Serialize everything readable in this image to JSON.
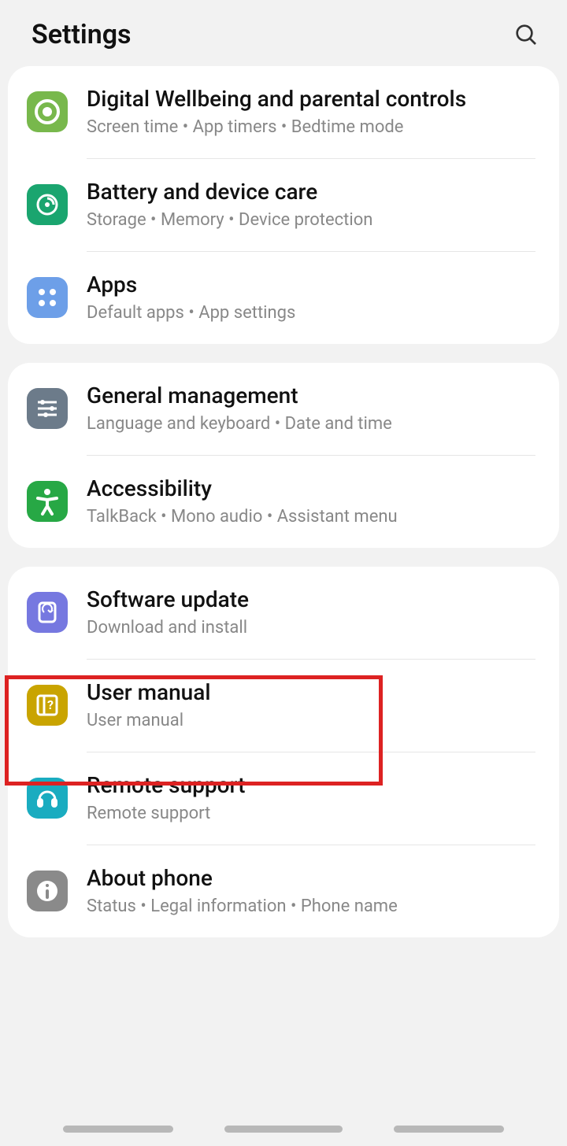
{
  "header": {
    "title": "Settings"
  },
  "groups": [
    {
      "items": [
        {
          "id": "digital-wellbeing",
          "title": "Digital Wellbeing and parental controls",
          "subtitle": "Screen time • App timers • Bedtime mode",
          "color": "#78b84c"
        },
        {
          "id": "battery",
          "title": "Battery and device care",
          "subtitle": "Storage • Memory • Device protection",
          "color": "#1aa56f"
        },
        {
          "id": "apps",
          "title": "Apps",
          "subtitle": "Default apps • App settings",
          "color": "#6d9fe8"
        }
      ]
    },
    {
      "items": [
        {
          "id": "general",
          "title": "General management",
          "subtitle": "Language and keyboard • Date and time",
          "color": "#6c7b8a"
        },
        {
          "id": "accessibility",
          "title": "Accessibility",
          "subtitle": "TalkBack • Mono audio • Assistant menu",
          "color": "#27a845"
        }
      ]
    },
    {
      "items": [
        {
          "id": "software-update",
          "title": "Software update",
          "subtitle": "Download and install",
          "color": "#7678e0"
        },
        {
          "id": "user-manual",
          "title": "User manual",
          "subtitle": "User manual",
          "color": "#c9a400"
        },
        {
          "id": "remote-support",
          "title": "Remote support",
          "subtitle": "Remote support",
          "color": "#1aacc0"
        },
        {
          "id": "about-phone",
          "title": "About phone",
          "subtitle": "Status • Legal information • Phone name",
          "color": "#8a8a8a"
        }
      ]
    }
  ],
  "highlighted_item": "software-update"
}
